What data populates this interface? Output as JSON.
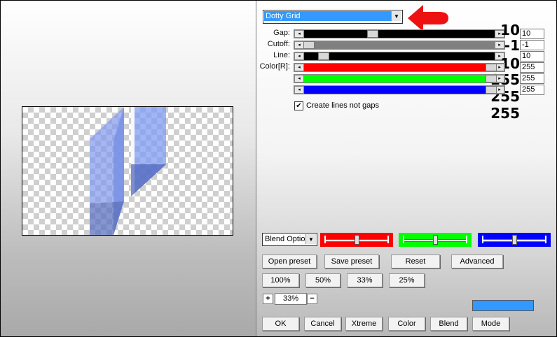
{
  "preset": {
    "selected": "Dotty Grid"
  },
  "sliders": [
    {
      "label": "Gap:",
      "value": "10",
      "big": "10",
      "fill": 0.35
    },
    {
      "label": "Cutoff:",
      "value": "-1",
      "big": "-1",
      "fill": 0.0
    },
    {
      "label": "Line:",
      "value": "10",
      "big": "10",
      "fill": 0.08
    },
    {
      "label": "Color[R]:",
      "value": "255",
      "big": "255",
      "fill": 1.0
    },
    {
      "label": "",
      "value": "255",
      "big": "255",
      "fill": 1.0
    },
    {
      "label": "",
      "value": "255",
      "big": "255",
      "fill": 1.0
    }
  ],
  "slider_colors": [
    "#000000",
    "#808080",
    "#000000",
    "#ff0000",
    "#00ff00",
    "#0000ff"
  ],
  "checkbox": {
    "label": "Create lines not gaps",
    "checked": true,
    "mark": "✔"
  },
  "blend": {
    "selected": "Blend Optio"
  },
  "channel_bars": [
    {
      "color": "#ff0000",
      "level": 0.5
    },
    {
      "color": "#00ff00",
      "level": 0.5
    },
    {
      "color": "#0000ff",
      "level": 0.5
    }
  ],
  "preset_buttons": {
    "open": "Open preset",
    "save": "Save preset",
    "reset": "Reset",
    "advanced": "Advanced"
  },
  "zoom_presets": [
    "100%",
    "50%",
    "33%",
    "25%"
  ],
  "zoom": {
    "plus": "+",
    "value": "33%",
    "minus": "−"
  },
  "swatch_color": "#3399ff",
  "footer": {
    "ok": "OK",
    "cancel": "Cancel",
    "xtreme": "Xtreme",
    "color": "Color",
    "blend": "Blend",
    "mode": "Mode"
  }
}
